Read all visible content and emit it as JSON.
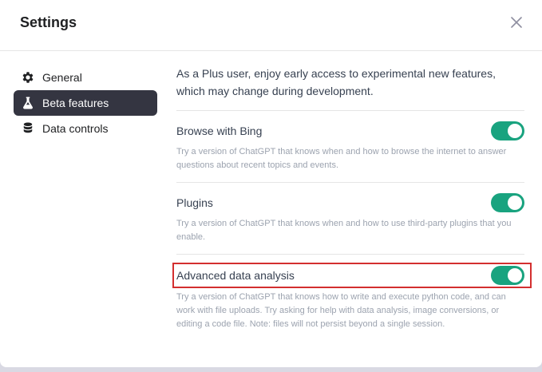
{
  "dialog": {
    "title": "Settings"
  },
  "sidebar": {
    "items": [
      {
        "label": "General",
        "icon": "gear-icon",
        "active": false
      },
      {
        "label": "Beta features",
        "icon": "flask-icon",
        "active": true
      },
      {
        "label": "Data controls",
        "icon": "database-icon",
        "active": false
      }
    ]
  },
  "beta": {
    "intro": "As a Plus user, enjoy early access to experimental new features, which may change during development.",
    "features": [
      {
        "label": "Browse with Bing",
        "description": "Try a version of ChatGPT that knows when and how to browse the internet to answer questions about recent topics and events.",
        "enabled": true
      },
      {
        "label": "Plugins",
        "description": "Try a version of ChatGPT that knows when and how to use third-party plugins that you enable.",
        "enabled": true
      },
      {
        "label": "Advanced data analysis",
        "description": "Try a version of ChatGPT that knows how to write and execute python code, and can work with file uploads. Try asking for help with data analysis, image conversions, or editing a code file. Note: files will not persist beyond a single session.",
        "enabled": true
      }
    ]
  },
  "colors": {
    "toggle_on": "#19a37f",
    "active_nav_bg": "#343541",
    "highlight": "#d32f2f"
  }
}
